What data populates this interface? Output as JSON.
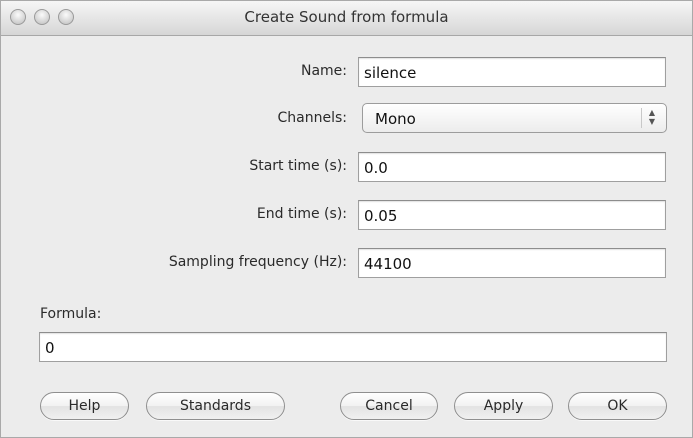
{
  "window": {
    "title": "Create Sound from formula"
  },
  "form": {
    "name_label": "Name:",
    "name_value": "silence",
    "channels_label": "Channels:",
    "channels_value": "Mono",
    "start_time_label": "Start time (s):",
    "start_time_value": "0.0",
    "end_time_label": "End time (s):",
    "end_time_value": "0.05",
    "sampling_label": "Sampling frequency (Hz):",
    "sampling_value": "44100",
    "formula_label": "Formula:",
    "formula_value": "0"
  },
  "buttons": {
    "help": "Help",
    "standards": "Standards",
    "cancel": "Cancel",
    "apply": "Apply",
    "ok": "OK"
  },
  "icons": {
    "close": "close-icon",
    "minimize": "minimize-icon",
    "zoom": "zoom-icon",
    "select_arrows": "updown-arrows-icon"
  }
}
